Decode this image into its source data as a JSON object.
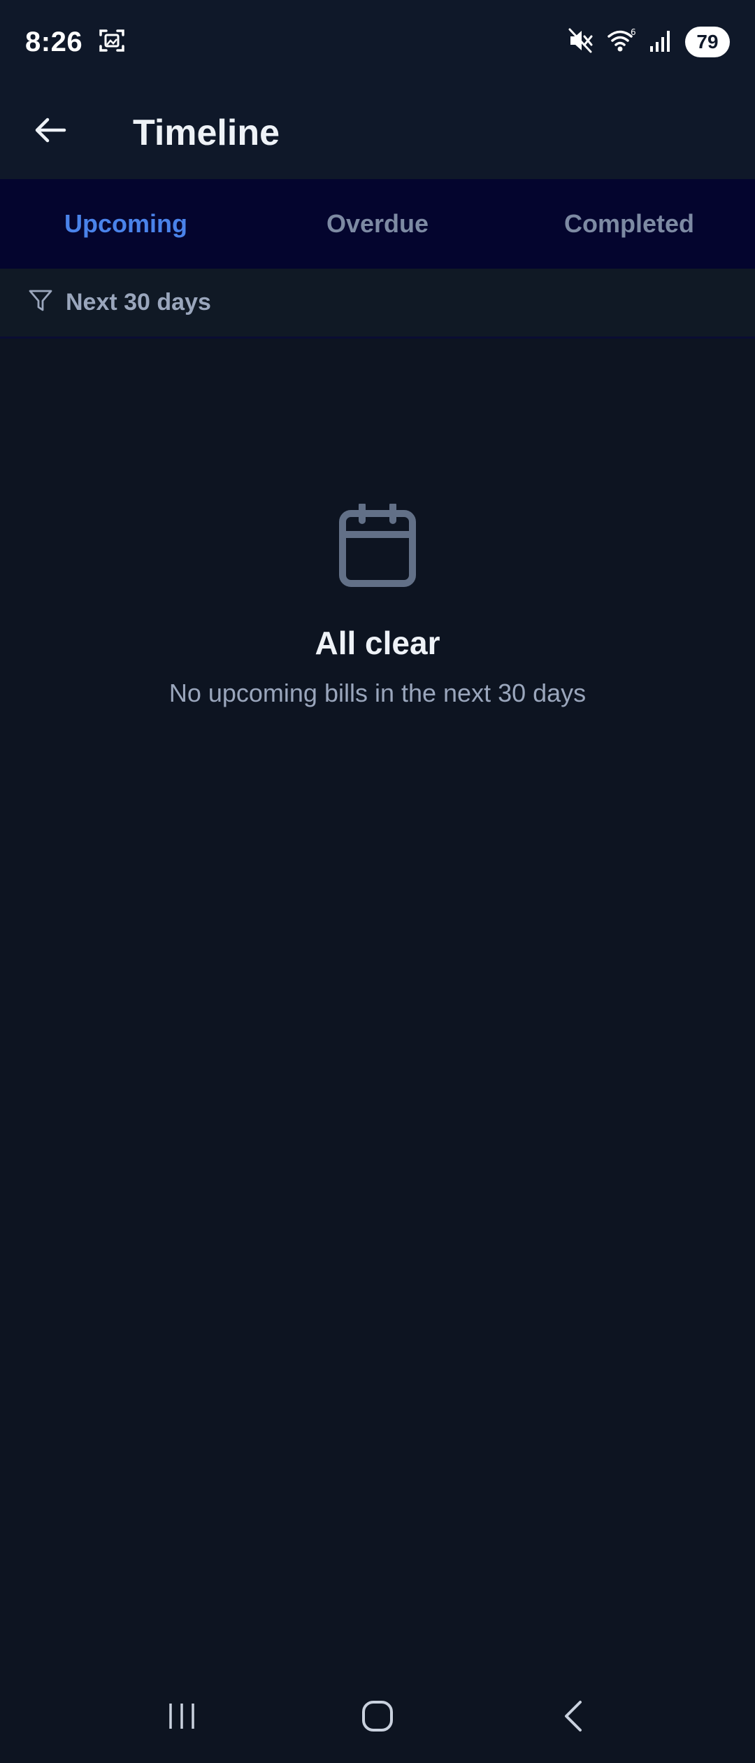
{
  "status_bar": {
    "time": "8:26",
    "battery": "79",
    "icons": [
      "screenshot-icon",
      "mute-icon",
      "wifi-icon",
      "signal-icon"
    ]
  },
  "app_bar": {
    "title": "Timeline",
    "back_icon": "arrow-left-icon"
  },
  "tabs": [
    {
      "label": "Upcoming",
      "active": true
    },
    {
      "label": "Overdue",
      "active": false
    },
    {
      "label": "Completed",
      "active": false
    }
  ],
  "filter": {
    "icon": "filter-icon",
    "label": "Next 30 days"
  },
  "empty_state": {
    "icon": "calendar-icon",
    "title": "All clear",
    "subtitle": "No upcoming bills in the next 30 days"
  },
  "nav_bar": {
    "buttons": [
      "recents-icon",
      "home-icon",
      "back-icon"
    ]
  },
  "colors": {
    "background": "#0d1421",
    "app_bar": "#0f1829",
    "tabs_background": "#04052e",
    "active_tab": "#4a83ea",
    "inactive_tab": "#7d8aa3",
    "muted_text": "#9aa6bc",
    "icon_gray": "#627087"
  }
}
